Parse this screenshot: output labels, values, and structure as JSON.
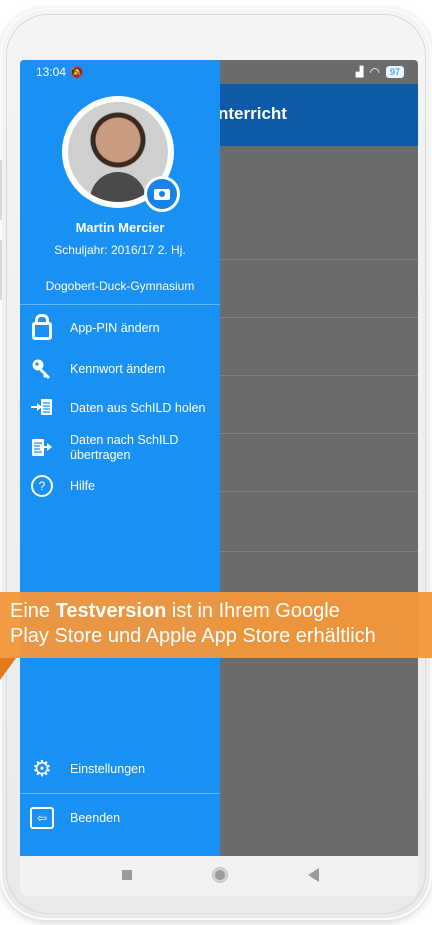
{
  "status_bar": {
    "time": "13:04",
    "battery": "97"
  },
  "app_bar": {
    "title_partial": "nterricht"
  },
  "drawer": {
    "user_name": "Martin Mercier",
    "school_year": "Schuljahr: 2016/17 2. Hj.",
    "school": "Dogobert-Duck-Gymnasium",
    "menu": [
      {
        "label": "App-PIN ändern",
        "icon": "lock-icon"
      },
      {
        "label": "Kennwort ändern",
        "icon": "key-icon"
      },
      {
        "label": "Daten aus SchILD holen",
        "icon": "import-icon"
      },
      {
        "label_line1": "Daten nach SchILD",
        "label_line2": "übertragen",
        "icon": "export-icon"
      },
      {
        "label": "Hilfe",
        "icon": "help-icon"
      }
    ],
    "bottom_menu": [
      {
        "label": "Einstellungen",
        "icon": "gear-icon"
      },
      {
        "label": "Beenden",
        "icon": "exit-icon"
      }
    ]
  },
  "banner": {
    "prefix": "Eine ",
    "bold": "Testversion",
    "suffix": " ist in Ihrem Google",
    "line2": "Play Store und Apple App Store erhältlich",
    "color": "#f4983a"
  },
  "colors": {
    "drawer": "#1990f3",
    "app_bar": "#0d5aa6",
    "overlay": "#6b6b6b"
  }
}
